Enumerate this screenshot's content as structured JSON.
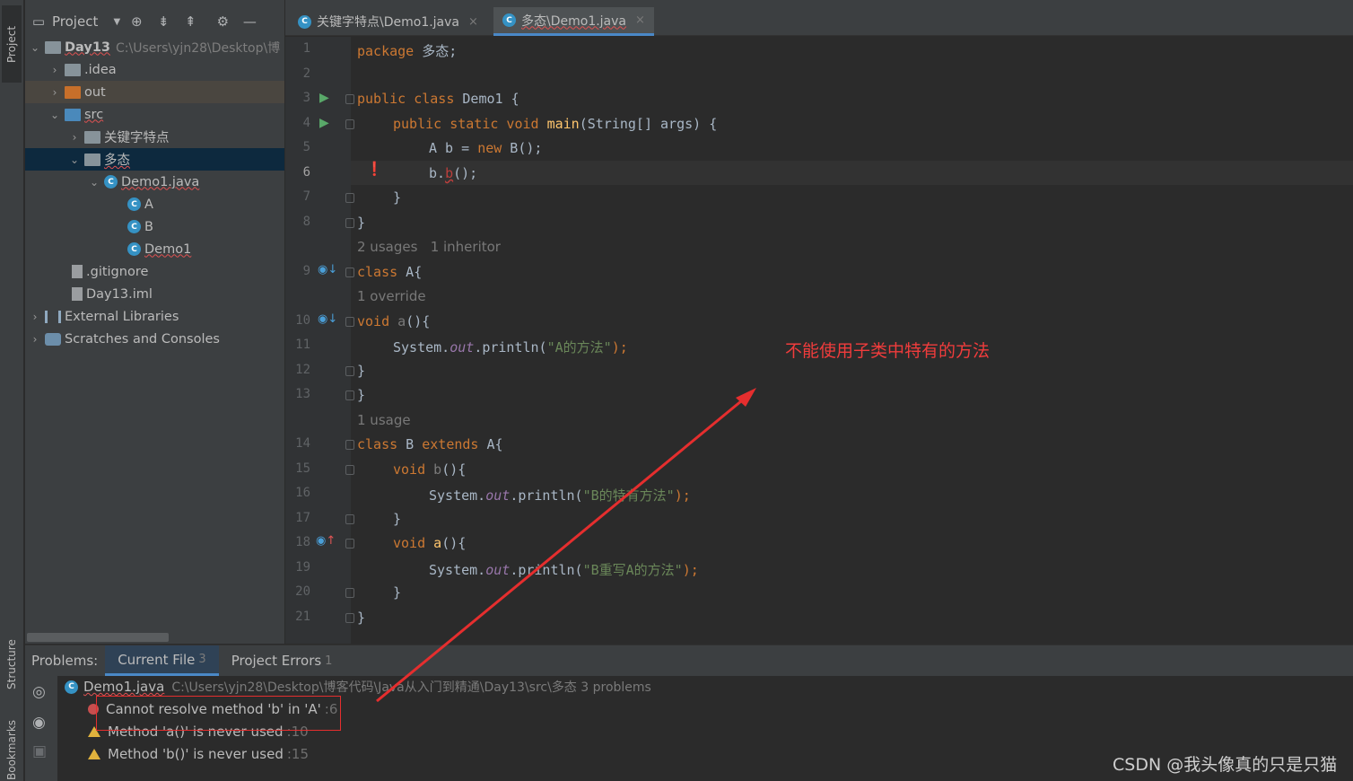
{
  "side_strip": {
    "project": "Project",
    "structure": "Structure",
    "bookmarks": "Bookmarks"
  },
  "project_panel": {
    "title": "Project",
    "tree": [
      {
        "label": "Day13",
        "hint": "C:\\Users\\yjn28\\Desktop\\博"
      },
      {
        "label": ".idea"
      },
      {
        "label": "out"
      },
      {
        "label": "src"
      },
      {
        "label": "关键字特点"
      },
      {
        "label": "多态"
      },
      {
        "label": "Demo1.java"
      },
      {
        "label": "A",
        "icon": "C"
      },
      {
        "label": "B",
        "icon": "C"
      },
      {
        "label": "Demo1",
        "icon": "C"
      },
      {
        "label": ".gitignore"
      },
      {
        "label": "Day13.iml"
      },
      {
        "label": "External Libraries"
      },
      {
        "label": "Scratches and Consoles"
      }
    ]
  },
  "tabs": [
    {
      "label": "关键字特点\\Demo1.java",
      "icon": "C",
      "close": "×"
    },
    {
      "label": "多态\\Demo1.java",
      "icon": "C",
      "close": "×"
    }
  ],
  "editor": {
    "line_numbers": [
      "1",
      "2",
      "3",
      "4",
      "5",
      "6",
      "7",
      "8",
      "9",
      "10",
      "11",
      "12",
      "13",
      "14",
      "15",
      "16",
      "17",
      "18",
      "19",
      "20",
      "21"
    ],
    "inlays": [
      "2 usages   1 inheritor",
      "1 override",
      "1 usage"
    ],
    "code": {
      "l1_kw": "package",
      "l1_rest": " 多态;",
      "l3_kw": "public class",
      "l3_rest": " Demo1 {",
      "l4_kw": "public static void",
      "l4_fn": " main",
      "l4_rest": "(String[] args) {",
      "l5_a": "A b = ",
      "l5_kw": "new",
      "l5_b": " B();",
      "l6_a": "b.",
      "l6_err": "b",
      "l6_b": "();",
      "l7": "}",
      "l8": "}",
      "l9_kw": "class",
      "l9_rest": " A{",
      "l10_kw": "void",
      "l10_dim": " a",
      "l10_rest": "(){",
      "l11_a": "System.",
      "l11_st": "out",
      "l11_b": ".println(",
      "l11_str": "\"A的方法\"",
      "l11_c": ");",
      "l12": "}",
      "l13": "}",
      "l14_kw": "class",
      "l14_mid": " B ",
      "l14_kw2": "extends",
      "l14_rest": " A{",
      "l15_kw": "void",
      "l15_dim": " b",
      "l15_rest": "(){",
      "l16_a": "System.",
      "l16_st": "out",
      "l16_b": ".println(",
      "l16_str": "\"B的特有方法\"",
      "l16_c": ");",
      "l17": "}",
      "l18_kw": "void",
      "l18_fn": " a",
      "l18_rest": "(){",
      "l19_a": "System.",
      "l19_st": "out",
      "l19_b": ".println(",
      "l19_str": "\"B重写A的方法\"",
      "l19_c": ");",
      "l20": "}",
      "l21": "}"
    }
  },
  "problems": {
    "title": "Problems:",
    "tabs": [
      {
        "label": "Current File",
        "count": "3"
      },
      {
        "label": "Project Errors",
        "count": "1"
      }
    ],
    "file": {
      "label": "Demo1.java",
      "path": "C:\\Users\\yjn28\\Desktop\\博客代码\\Java从入门到精通\\Day13\\src\\多态  3 problems"
    },
    "items": [
      {
        "severity": "error",
        "text": "Cannot resolve method 'b' in 'A'",
        "line": ":6"
      },
      {
        "severity": "warning",
        "text": "Method 'a()' is never used",
        "line": ":10"
      },
      {
        "severity": "warning",
        "text": "Method 'b()' is never used",
        "line": ":15"
      }
    ]
  },
  "annotation": {
    "text": "不能使用子类中特有的方法",
    "color": "#f03c3c"
  },
  "watermark": "CSDN @我头像真的只是只猫",
  "colors": {
    "keyword": "#cc7832",
    "function": "#ffc66d",
    "string": "#6a8759",
    "static_field": "#9876aa",
    "error": "#bc3f3c",
    "accent": "#4a88c7"
  }
}
